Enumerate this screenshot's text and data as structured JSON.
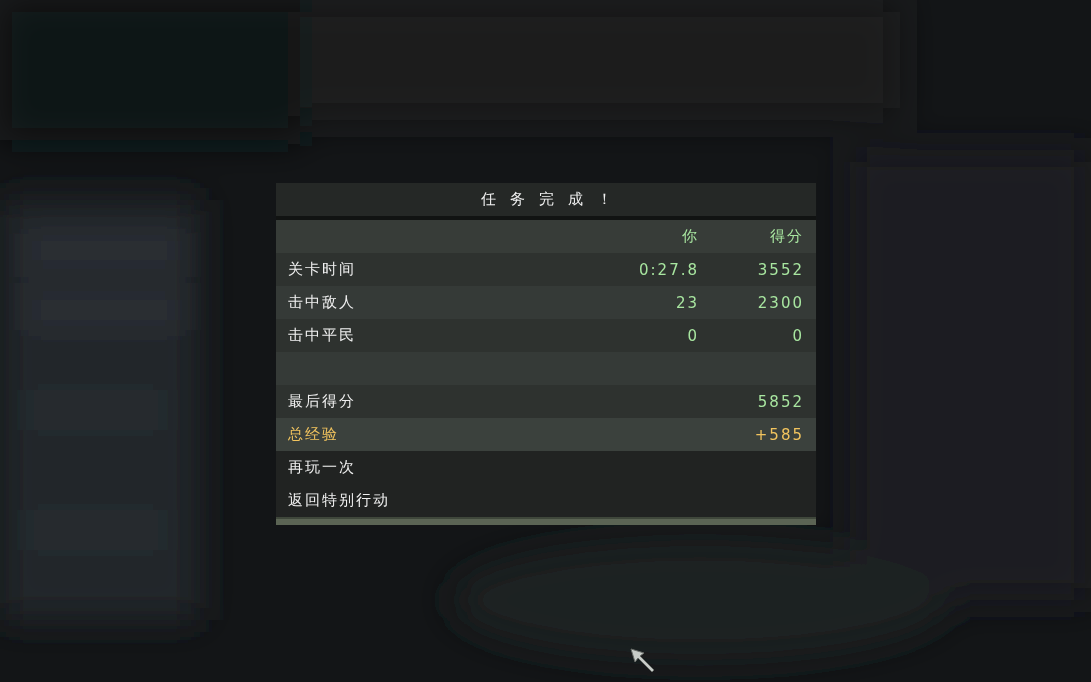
{
  "dialog": {
    "title": "任务完成！",
    "columns": [
      "你",
      "得分"
    ],
    "rows": [
      {
        "kind": "stat",
        "label": "关卡时间",
        "you": "0:27.8",
        "score": "3552"
      },
      {
        "kind": "stat",
        "label": "击中敌人",
        "you": "23",
        "score": "2300"
      },
      {
        "kind": "stat",
        "label": "击中平民",
        "you": "0",
        "score": "0"
      },
      {
        "kind": "spacer"
      },
      {
        "kind": "total",
        "label": "最后得分",
        "score": "5852"
      },
      {
        "kind": "reward",
        "label": "总经验",
        "score": "+585"
      }
    ],
    "menu": [
      {
        "label": "再玩一次"
      },
      {
        "label": "返回特别行动"
      }
    ]
  }
}
